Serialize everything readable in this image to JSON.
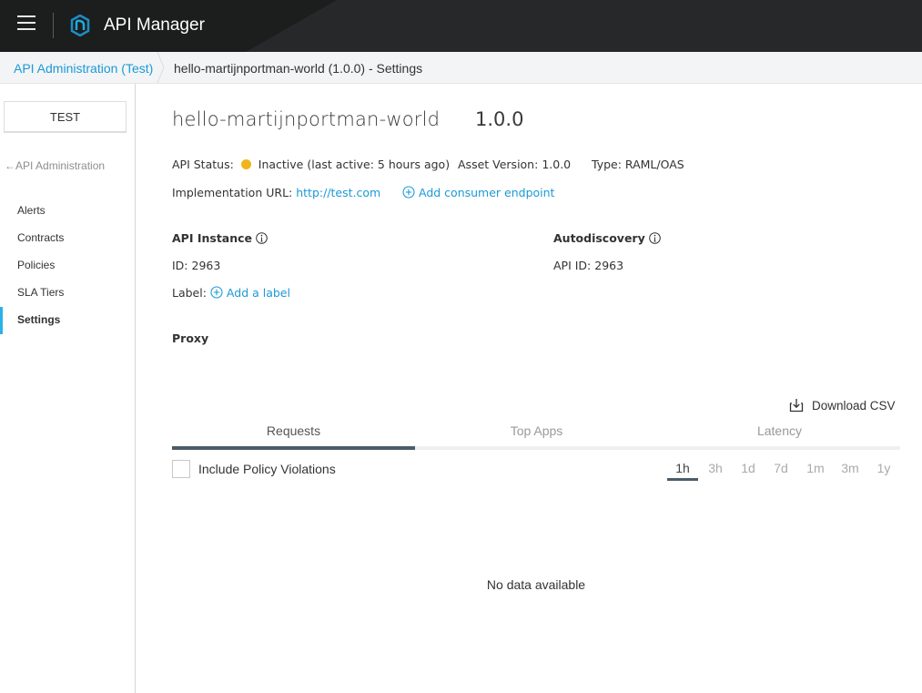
{
  "header": {
    "app_title": "API Manager",
    "menu_icon": "hamburger-menu-icon",
    "logo_icon": "mulesoft-hexagon-logo"
  },
  "breadcrumb": {
    "items": [
      {
        "label": "API Administration (Test)"
      },
      {
        "label": "hello-martijnportman-world (1.0.0) - Settings"
      }
    ]
  },
  "sidebar": {
    "environment": "TEST",
    "back_link": "API Administration",
    "back_icon": "arrow-left-icon",
    "items": [
      {
        "label": "Alerts",
        "active": false
      },
      {
        "label": "Contracts",
        "active": false
      },
      {
        "label": "Policies",
        "active": false
      },
      {
        "label": "SLA Tiers",
        "active": false
      },
      {
        "label": "Settings",
        "active": true
      }
    ],
    "accent_color": "#2ab2e8"
  },
  "api": {
    "name": "hello-martijnportman-world",
    "version": "1.0.0",
    "status_label": "API Status:",
    "status_value": "Inactive (last active: 5 hours ago)",
    "status_color": "#f0b41c",
    "asset_version_label": "Asset Version:",
    "asset_version": "1.0.0",
    "type_label": "Type:",
    "type": "RAML/OAS",
    "impl_url_label": "Implementation URL:",
    "impl_url": "http://test.com",
    "add_consumer_endpoint": "Add consumer endpoint"
  },
  "instance": {
    "title": "API Instance",
    "id_label": "ID:",
    "id": "2963",
    "label_label": "Label:",
    "add_label": "Add a label"
  },
  "autodiscovery": {
    "title": "Autodiscovery",
    "api_id_label": "API ID:",
    "api_id": "2963"
  },
  "proxy": {
    "title": "Proxy"
  },
  "analytics": {
    "download_csv": "Download CSV",
    "tabs": [
      {
        "label": "Requests",
        "active": true
      },
      {
        "label": "Top Apps",
        "active": false
      },
      {
        "label": "Latency",
        "active": false
      }
    ],
    "include_violations_label": "Include Policy Violations",
    "include_violations_checked": false,
    "ranges": [
      {
        "label": "1h",
        "active": true
      },
      {
        "label": "3h",
        "active": false
      },
      {
        "label": "1d",
        "active": false
      },
      {
        "label": "7d",
        "active": false
      },
      {
        "label": "1m",
        "active": false
      },
      {
        "label": "3m",
        "active": false
      },
      {
        "label": "1y",
        "active": false
      }
    ],
    "empty_message": "No data available"
  },
  "colors": {
    "link": "#1b9ad6",
    "header_bg": "#27282a",
    "tab_indicator": "#4b5c68"
  }
}
